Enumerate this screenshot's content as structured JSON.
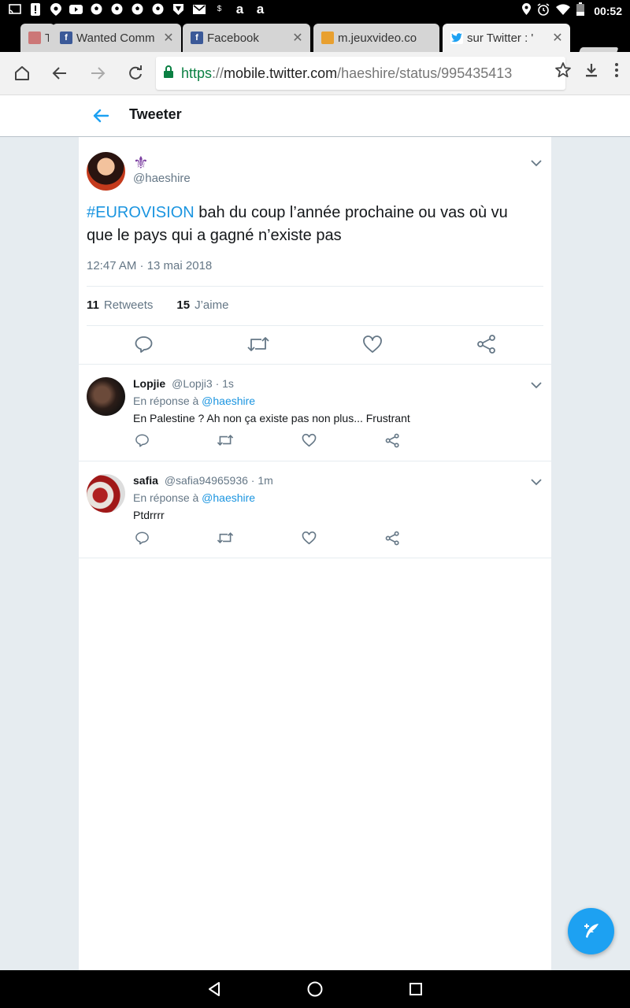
{
  "status_bar": {
    "time": "00:52",
    "left_icons": [
      "cast-icon",
      "alert-icon",
      "location-badge-icon",
      "youtube-icon",
      "soccer-ball-icon",
      "soccer-ball-icon",
      "soccer-ball-icon",
      "soccer-ball-icon",
      "shield-icon",
      "gmail-icon",
      "dollar-icon",
      "amazon-icon",
      "amazon-icon"
    ],
    "right_icons": [
      "location-icon",
      "alarm-icon",
      "wifi-icon",
      "battery-icon"
    ]
  },
  "tabs": [
    {
      "title": "T",
      "favicon": "game-icon",
      "active": false
    },
    {
      "title": "Wanted Comm",
      "favicon": "facebook-icon",
      "active": false
    },
    {
      "title": "Facebook",
      "favicon": "facebook-icon",
      "active": false
    },
    {
      "title": "m.jeuxvideo.co",
      "favicon": "jeuxvideo-icon",
      "active": false
    },
    {
      "title": "sur Twitter : '",
      "favicon": "twitter-icon",
      "active": true
    }
  ],
  "address_bar": {
    "scheme": "https",
    "separator": "://",
    "host": "mobile.twitter.com",
    "path": "/haeshire/status/995435413"
  },
  "header": {
    "title": "Tweeter"
  },
  "main_tweet": {
    "display_name": "⚜",
    "handle": "@haeshire",
    "hashtag": "#EUROVISION",
    "text": " bah du coup l’année prochaine ou vas où vu que le pays qui a gagné n’existe pas",
    "timestamp": "12:47 AM · 13 mai 2018",
    "retweet_count": "11",
    "retweet_label": "Retweets",
    "like_count": "15",
    "like_label": "J’aime"
  },
  "replies": [
    {
      "name": "Lopjie",
      "handle": "@Lopji3",
      "time": "· 1s",
      "context_prefix": "En réponse à ",
      "mention": "@haeshire",
      "text": "En Palestine ? Ah non ça existe pas non plus... Frustrant"
    },
    {
      "name": "safia",
      "handle": "@safia94965936",
      "time": "· 1m",
      "context_prefix": "En réponse à ",
      "mention": "@haeshire",
      "text": "Ptdrrrr"
    }
  ],
  "colors": {
    "twitter_blue": "#1da1f2",
    "link_blue": "#1b95e0",
    "muted_text": "#657786",
    "secure_green": "#0b8043"
  }
}
